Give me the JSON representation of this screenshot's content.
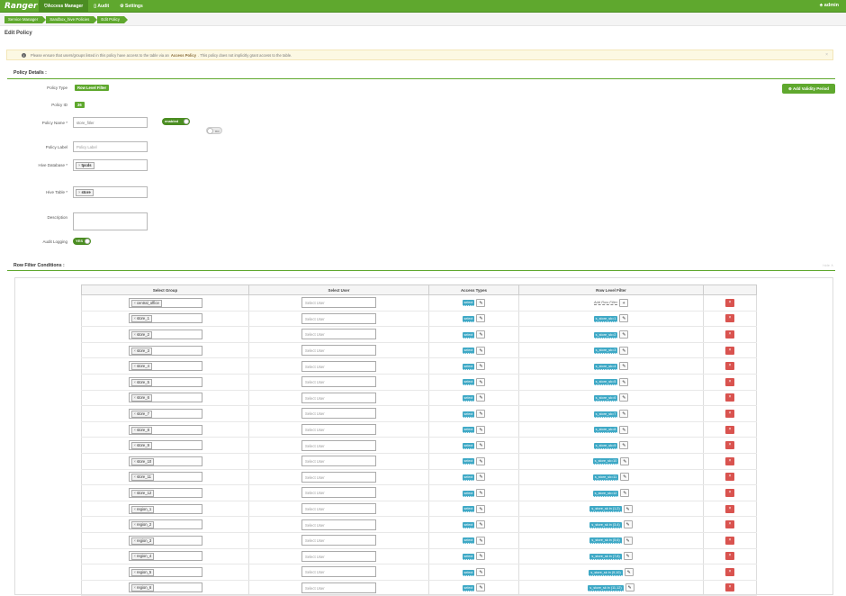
{
  "app": {
    "brand": "Ranger",
    "user": "admin"
  },
  "nav": [
    {
      "label": "Access Manager",
      "icon": "shield-icon"
    },
    {
      "label": "Audit",
      "icon": "file-icon"
    },
    {
      "label": "Settings",
      "icon": "gear-icon"
    }
  ],
  "breadcrumbs": [
    "Service Manager",
    "Sandbox_hive Policies",
    "Edit Policy"
  ],
  "page_title": "Edit Policy",
  "notice": {
    "text_before": "Please ensure that users/groups listed in this policy have access to the table via an",
    "link": "Access Policy",
    "text_after": ". This policy does not implicitly grant access to the table.",
    "close": "×"
  },
  "details": {
    "section_title": "Policy Details :",
    "policy_type_label": "Policy Type",
    "policy_type_value": "Row Level Filter",
    "policy_id_label": "Policy ID",
    "policy_id_value": "36",
    "policy_name_label": "Policy Name *",
    "policy_name_value": "store_fitler",
    "enabled_label": "enabled",
    "override_label": "no",
    "policy_label_label": "Policy Label",
    "policy_label_placeholder": "Policy Label",
    "hive_db_label": "Hive Database *",
    "hive_db_value": "tpcds",
    "hive_table_label": "Hive Table *",
    "hive_table_value": "store",
    "description_label": "Description",
    "audit_label": "Audit Logging",
    "audit_value": "YES",
    "validity_button": "Add Validity Period"
  },
  "conditions": {
    "section_title": "Row Filter Conditions :",
    "hide_link": "hide ∧",
    "headers": [
      "Select Group",
      "Select User",
      "Access Types",
      "Row Level Filter",
      ""
    ],
    "user_placeholder": "Select User",
    "access_type": "select",
    "add_filter_label": "Add Row Filter",
    "rows": [
      {
        "group": "central_office",
        "filter": ""
      },
      {
        "group": "store_1",
        "filter": "s_store_sk=1"
      },
      {
        "group": "store_2",
        "filter": "s_store_sk=2"
      },
      {
        "group": "store_3",
        "filter": "s_store_sk=3"
      },
      {
        "group": "store_4",
        "filter": "s_store_sk=4"
      },
      {
        "group": "store_5",
        "filter": "s_store_sk=5"
      },
      {
        "group": "store_6",
        "filter": "s_store_sk=6"
      },
      {
        "group": "store_7",
        "filter": "s_store_sk=7"
      },
      {
        "group": "store_8",
        "filter": "s_store_sk=8"
      },
      {
        "group": "store_9",
        "filter": "s_store_sk=9"
      },
      {
        "group": "store_10",
        "filter": "s_store_sk=10"
      },
      {
        "group": "store_11",
        "filter": "s_store_sk=11"
      },
      {
        "group": "store_12",
        "filter": "s_store_sk=12"
      },
      {
        "group": "region_1",
        "filter": "s_store_sk in (1,2)"
      },
      {
        "group": "region_2",
        "filter": "s_store_sk in (3,4)"
      },
      {
        "group": "region_3",
        "filter": "s_store_sk in (5,6)"
      },
      {
        "group": "region_4",
        "filter": "s_store_sk in (7,8)"
      },
      {
        "group": "region_5",
        "filter": "s_store_sk in (9,10)"
      },
      {
        "group": "region_6",
        "filter": "s_store_sk in (11,12)"
      }
    ]
  }
}
